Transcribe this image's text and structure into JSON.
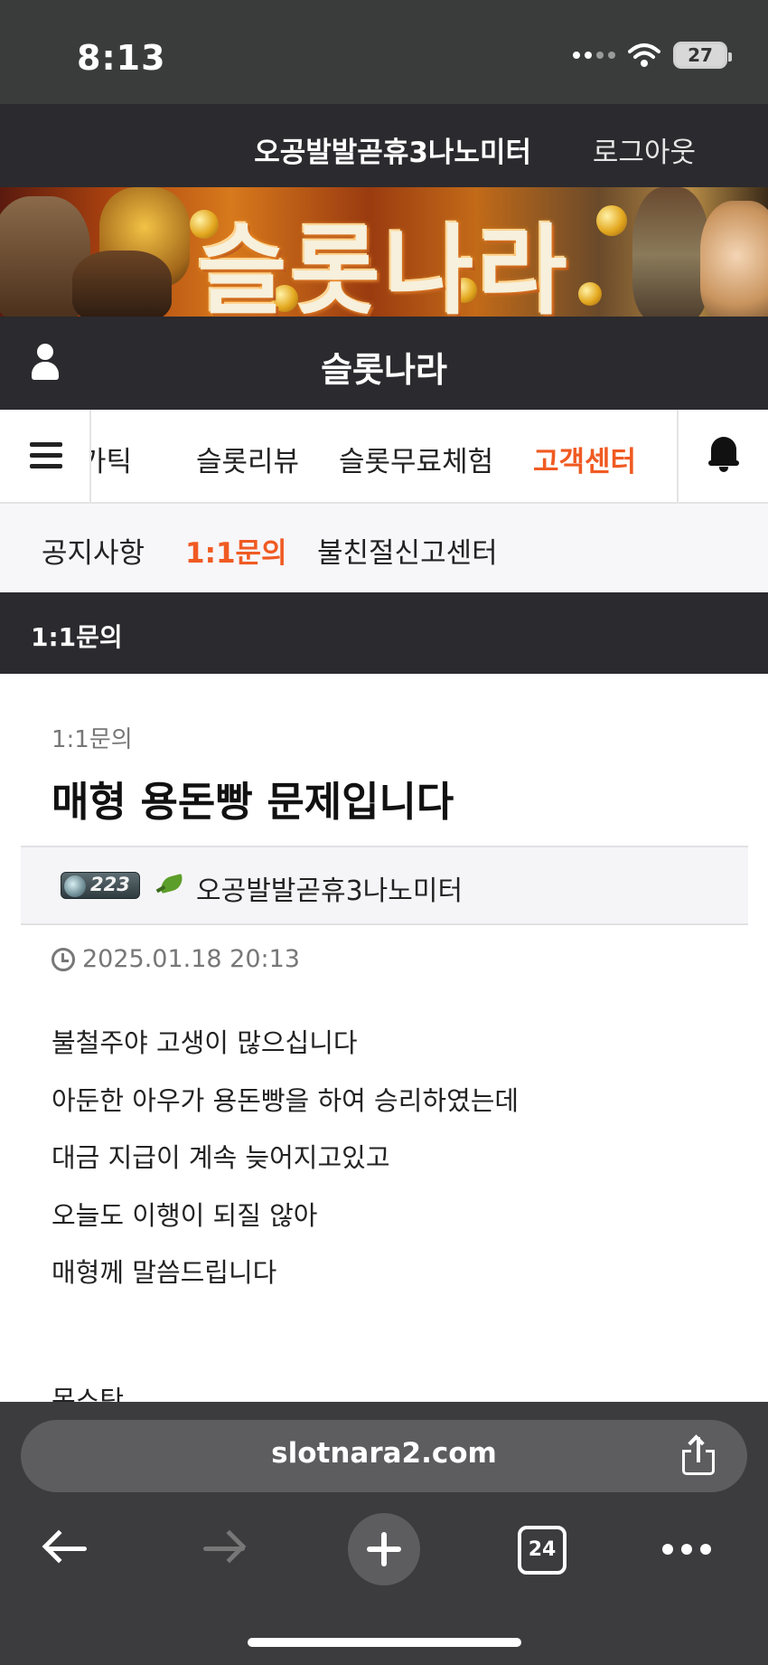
{
  "status_bar": {
    "time": "8:13",
    "battery": "27",
    "icons": [
      "signal-icon",
      "wifi-icon",
      "battery-icon"
    ]
  },
  "top_bar": {
    "username": "오공발발곧휴3나노미터",
    "logout_label": "로그아웃"
  },
  "banner": {
    "title": "슬롯나라"
  },
  "site_header": {
    "title": "슬롯나라",
    "user_icon": "user-icon"
  },
  "nav": {
    "items": [
      {
        "label": "가틱",
        "active": false
      },
      {
        "label": "슬롯리뷰",
        "active": false
      },
      {
        "label": "슬롯무료체험",
        "active": false
      },
      {
        "label": "고객센터",
        "active": true
      }
    ],
    "menu_icon": "hamburger-menu-icon",
    "bell_icon": "bell-icon",
    "accent_color": "#f05a22"
  },
  "sub_nav": {
    "items": [
      {
        "label": "공지사항",
        "active": false
      },
      {
        "label": "1:1문의",
        "active": true
      },
      {
        "label": "불친절신고센터",
        "active": false
      }
    ]
  },
  "section": {
    "title": "1:1문의"
  },
  "post": {
    "category": "1:1문의",
    "title": "매형 용돈빵 문제입니다",
    "author": {
      "level": "223",
      "name": "오공발발곧휴3나노미터"
    },
    "date": "2025.01.18 20:13",
    "body_lines": [
      "불철주야 고생이 많으십니다",
      "아둔한 아우가 용돈빵을 하여 승리하였는데",
      "대금 지급이 계속 늦어지고있고",
      "오늘도 이행이 되질 않아",
      "매형께 말씀드립니다"
    ],
    "cut_line": "몬스탄"
  },
  "browser": {
    "url": "slotnara2.com",
    "tab_count": "24"
  },
  "colors": {
    "dark_bar": "#2b2a2e",
    "status_bar": "#3a3c3c",
    "toolbar": "#3c3c3e",
    "accent": "#f05a22"
  }
}
